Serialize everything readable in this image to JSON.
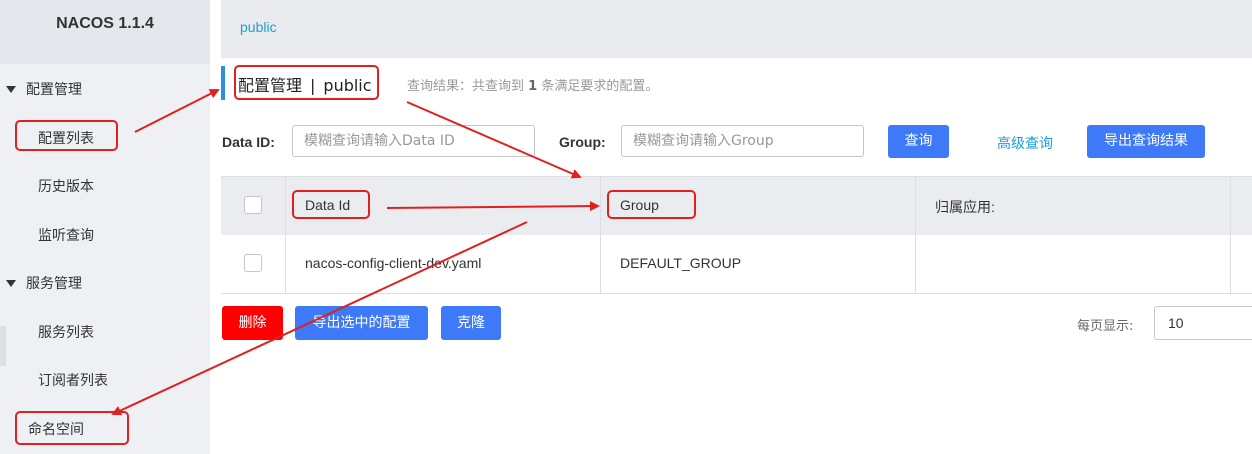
{
  "app": {
    "brand": "NACOS 1.1.4"
  },
  "sidebar": {
    "groups": [
      {
        "label": "配置管理",
        "items": [
          "配置列表",
          "历史版本",
          "监听查询"
        ]
      },
      {
        "label": "服务管理",
        "items": [
          "服务列表",
          "订阅者列表"
        ]
      }
    ],
    "namespace": "命名空间"
  },
  "breadcrumb": {
    "namespace": "public"
  },
  "page": {
    "title_main": "配置管理",
    "title_sep": "|",
    "title_ns": "public",
    "query_prefix": "查询结果：共查询到",
    "query_count": "1",
    "query_suffix": "条满足要求的配置。"
  },
  "search": {
    "data_id_label": "Data ID:",
    "data_id_placeholder": "模糊查询请输入Data ID",
    "group_label": "Group:",
    "group_placeholder": "模糊查询请输入Group",
    "query_button": "查询",
    "advanced_link": "高级查询",
    "export_button": "导出查询结果"
  },
  "table": {
    "columns": [
      "Data Id",
      "Group",
      "归属应用:"
    ],
    "rows": [
      {
        "data_id": "nacos-config-client-dev.yaml",
        "group": "DEFAULT_GROUP",
        "app": ""
      }
    ]
  },
  "actions": {
    "delete": "删除",
    "export_selected": "导出选中的配置",
    "clone": "克隆"
  },
  "pagination": {
    "label": "每页显示:",
    "page_size": "10"
  },
  "colors": {
    "primary": "#3e79f7",
    "danger": "#fd0000",
    "link": "#1aa0d8",
    "annotation": "#e02020"
  }
}
